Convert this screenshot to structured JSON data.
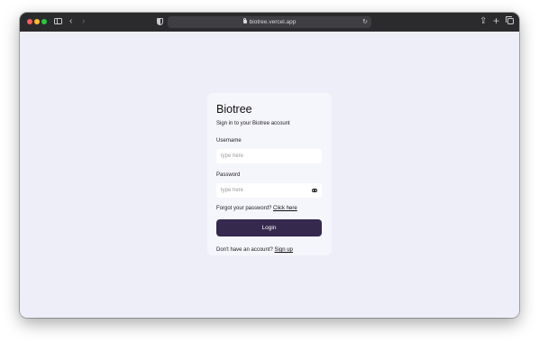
{
  "browser": {
    "url": "biotree.vercel.app",
    "icons": {
      "back": "chevron-left-icon",
      "forward": "chevron-right-icon",
      "share": "share-icon",
      "new_tab": "plus-icon",
      "tabs": "tabs-overview-icon"
    },
    "glyphs": {
      "back": "‹",
      "forward": "›",
      "reload": "↻",
      "share": "⇪",
      "plus": "+"
    }
  },
  "login": {
    "brand": "Biotree",
    "subtitle": "Sign in to your Biotree account",
    "username_label": "Username",
    "username_placeholder": "type here",
    "username_value": "",
    "password_label": "Password",
    "password_placeholder": "type here",
    "password_value": "",
    "forgot_text": "Forgot your password?",
    "forgot_link": "Click here",
    "login_button": "Login",
    "signup_text": "Don't have an account?",
    "signup_link": "Sign up"
  },
  "colors": {
    "page_background": "#eeeef9",
    "card_background": "#f5f5fc",
    "button_background": "#35294d",
    "button_text": "#ffffff",
    "toolbar_background": "#2b2b2e"
  }
}
